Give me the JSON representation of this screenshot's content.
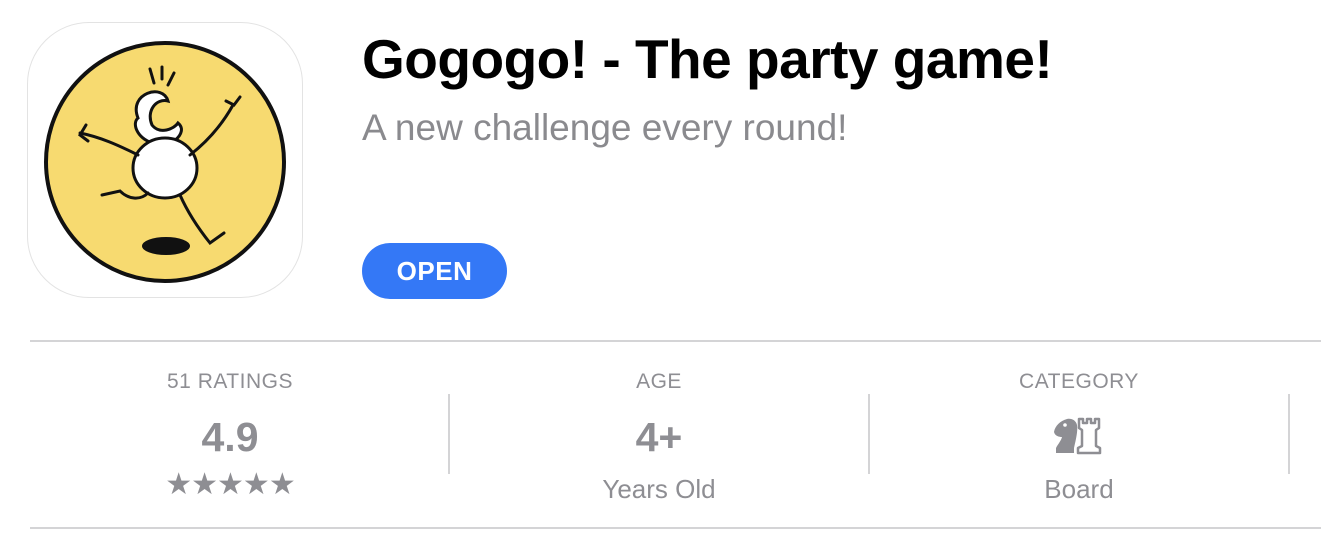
{
  "app": {
    "title": "Gogogo! - The party game!",
    "subtitle": "A new challenge every round!",
    "icon": "stick-figure-app-icon",
    "action_label": "OPEN",
    "accent_color": "#3478f6"
  },
  "info": {
    "ratings": {
      "label": "51 RATINGS",
      "value": "4.9",
      "stars": "★★★★★",
      "star_rating": 5
    },
    "age": {
      "label": "AGE",
      "value": "4+",
      "sub": "Years Old"
    },
    "category": {
      "label": "CATEGORY",
      "icon": "chess-pieces-icon",
      "sub": "Board"
    }
  }
}
